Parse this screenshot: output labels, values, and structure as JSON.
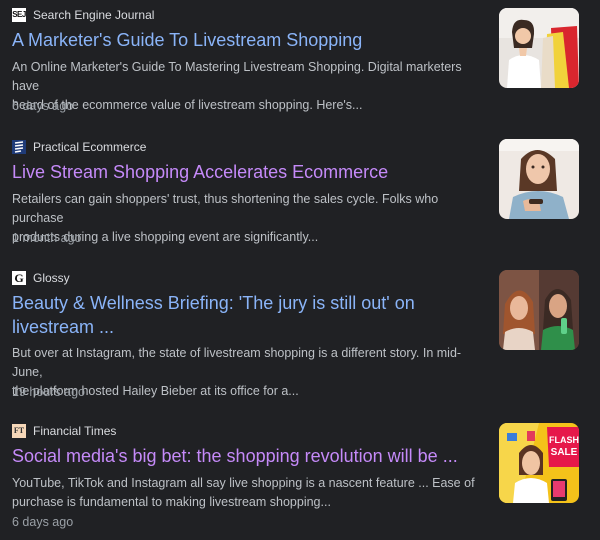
{
  "articles": [
    {
      "source": "Search Engine Journal",
      "icon": "sej-logo-icon",
      "title": "A Marketer's Guide To Livestream Shopping",
      "snippet_lines": [
        "An Online Marketer's Guide To Mastering Livestream Shopping. Digital marketers have",
        "heard of the ecommerce value of livestream shopping. Here's..."
      ],
      "age": "6 days ago",
      "visited": false
    },
    {
      "source": "Practical Ecommerce",
      "icon": "practical-ecommerce-logo-icon",
      "title": "Live Stream Shopping Accelerates Ecommerce",
      "snippet_lines": [
        "Retailers can gain shoppers' trust, thus shortening the sales cycle. Folks who purchase",
        "products during a live shopping event are significantly..."
      ],
      "age": "1 month ago",
      "visited": true
    },
    {
      "source": "Glossy",
      "icon": "glossy-logo-icon",
      "title_lines": [
        "Beauty & Wellness Briefing: 'The jury is still out' on",
        "livestream ..."
      ],
      "snippet_lines": [
        "But over at Instagram, the state of livestream shopping is a different story. In mid-June,",
        "the platform hosted Hailey Bieber at its office for a..."
      ],
      "age": "19 hours ago",
      "visited": false
    },
    {
      "source": "Financial Times",
      "icon": "ft-logo-icon",
      "title": "Social media's big bet: the shopping revolution will be ...",
      "snippet_lines": [
        "YouTube, TikTok and Instagram all say live shopping is a nascent feature ... Ease of",
        "purchase is fundamental to making livestream shopping..."
      ],
      "age": "6 days ago",
      "visited": true,
      "thumb_text": [
        "FLASH",
        "SALE"
      ]
    }
  ],
  "icon_text": {
    "sej": "SEJ",
    "glossy": "G",
    "ft": "FT"
  },
  "colors": {
    "background": "#202124",
    "link_unvisited": "#8ab4f8",
    "link_visited": "#c58af9",
    "snippet": "#bdc1c6",
    "meta": "#9aa0a6"
  }
}
